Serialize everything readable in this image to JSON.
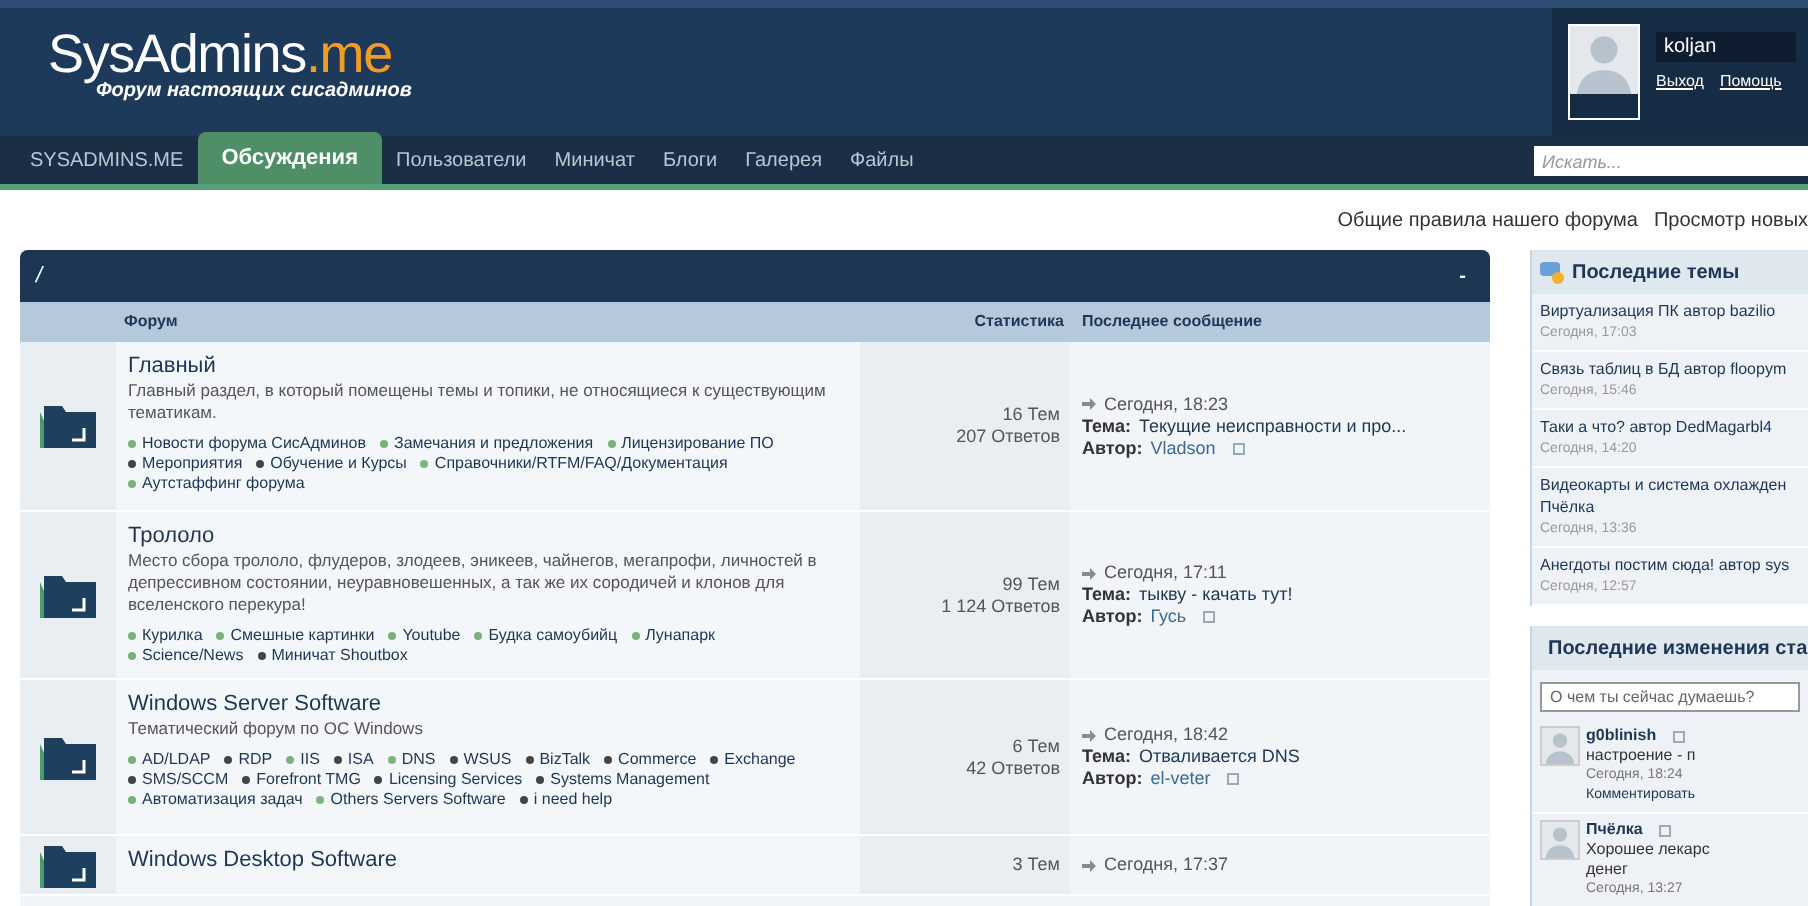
{
  "header": {
    "logo_main": "SysAdmins",
    "logo_accent": ".me",
    "tagline": "Форум настоящих сисадминов",
    "user": {
      "name": "koljan",
      "links": [
        "Выход",
        "Помощь"
      ]
    }
  },
  "nav": {
    "tabs": [
      {
        "label": "SYSADMINS.ME",
        "selected": false
      },
      {
        "label": "Обсуждения",
        "selected": true
      },
      {
        "label": "Пользователи",
        "selected": false
      },
      {
        "label": "Миничат",
        "selected": false
      },
      {
        "label": "Блоги",
        "selected": false
      },
      {
        "label": "Галерея",
        "selected": false
      },
      {
        "label": "Файлы",
        "selected": false
      }
    ],
    "search": {
      "placeholder": "Искать..."
    }
  },
  "top_links": [
    "Общие правила нашего форума",
    "Просмотр новых"
  ],
  "category": {
    "title": "/",
    "collapse": "-",
    "columns": [
      "Форум",
      "Статистика",
      "Последнее сообщение"
    ],
    "forums": [
      {
        "name": "Главный",
        "description": "Главный раздел, в который помещены темы и топики, не относящиеся к существующим тематикам.",
        "subforums": [
          {
            "name": "Новости форума СисАдминов",
            "new": true
          },
          {
            "name": "Замечания и предложения",
            "new": true
          },
          {
            "name": "Лицензирование ПО",
            "new": true
          },
          {
            "name": "Мероприятия",
            "new": false
          },
          {
            "name": "Обучение и Курсы",
            "new": false
          },
          {
            "name": "Справочники/RTFM/FAQ/Документация",
            "new": true
          },
          {
            "name": "Аутстаффинг форума",
            "new": true
          }
        ],
        "topics": "16 Тем",
        "replies": "207 Ответов",
        "last": {
          "date": "Сегодня, 18:23",
          "topic_label": "Тема:",
          "topic": "Текущие неисправности и про...",
          "author_label": "Автор:",
          "author": "Vladson"
        }
      },
      {
        "name": "Трололо",
        "description": "Место сбора трололо, флудеров, злодеев, эникеев, чайнегов, мегапрофи, личностей в депрессивном состоянии, неуравновешенных, а так же их сородичей и клонов для вселенского перекура!",
        "subforums": [
          {
            "name": "Курилка",
            "new": true
          },
          {
            "name": "Смешные картинки",
            "new": true
          },
          {
            "name": "Youtube",
            "new": true
          },
          {
            "name": "Будка самоубийц",
            "new": true
          },
          {
            "name": "Лунапарк",
            "new": true
          },
          {
            "name": "Science/News",
            "new": true
          },
          {
            "name": "Миничат Shoutbox",
            "new": false
          }
        ],
        "topics": "99 Тем",
        "replies": "1 124 Ответов",
        "last": {
          "date": "Сегодня, 17:11",
          "topic_label": "Тема:",
          "topic": "тыкву - качать тут!",
          "author_label": "Автор:",
          "author": "Гусь"
        }
      },
      {
        "name": "Windows Server Software",
        "description": "Тематический форум по ОС Windows",
        "subforums": [
          {
            "name": "AD/LDAP",
            "new": true
          },
          {
            "name": "RDP",
            "new": false
          },
          {
            "name": "IIS",
            "new": true
          },
          {
            "name": "ISA",
            "new": false
          },
          {
            "name": "DNS",
            "new": true
          },
          {
            "name": "WSUS",
            "new": false
          },
          {
            "name": "BizTalk",
            "new": false
          },
          {
            "name": "Commerce",
            "new": false
          },
          {
            "name": "Exchange",
            "new": false
          },
          {
            "name": "SMS/SCCM",
            "new": false
          },
          {
            "name": "Forefront TMG",
            "new": false
          },
          {
            "name": "Licensing Services",
            "new": false
          },
          {
            "name": "Systems Management",
            "new": false
          },
          {
            "name": "Автоматизация задач",
            "new": true
          },
          {
            "name": "Others Servers Software",
            "new": true
          },
          {
            "name": "i need help",
            "new": false
          }
        ],
        "topics": "6 Тем",
        "replies": "42 Ответов",
        "last": {
          "date": "Сегодня, 18:42",
          "topic_label": "Тема:",
          "topic": "Отваливается DNS",
          "author_label": "Автор:",
          "author": "el-veter"
        }
      },
      {
        "name": "Windows Desktop Software",
        "topics": "3 Тем",
        "last": {
          "date": "Сегодня, 17:37"
        }
      }
    ]
  },
  "sidebar": {
    "recent_title": "Последние темы",
    "recent": [
      {
        "title": "Виртуализация ПК автор bazilio",
        "time": "Сегодня, 17:03"
      },
      {
        "title": "Связь таблиц в БД автор floopym",
        "time": "Сегодня, 15:46"
      },
      {
        "title": "Таки а что? автор DedMagarbl4",
        "time": "Сегодня, 14:20"
      },
      {
        "title": "Видеокарты и система охлажден",
        "title2": "Пчёлка",
        "time": "Сегодня, 13:36"
      },
      {
        "title": "Анегдоты постим сюда! автор sys",
        "time": "Сегодня, 12:57"
      }
    ],
    "status_title": "Последние изменения ста",
    "status_placeholder": "О чем ты сейчас думаешь?",
    "statuses": [
      {
        "user": "g0blinish",
        "text": "настроение - п",
        "time": "Сегодня, 18:24",
        "action": "Комментировать"
      },
      {
        "user": "Пчёлка",
        "text": "Хорошее лекарс",
        "text2": "денег",
        "time": "Сегодня, 13:27"
      }
    ]
  }
}
